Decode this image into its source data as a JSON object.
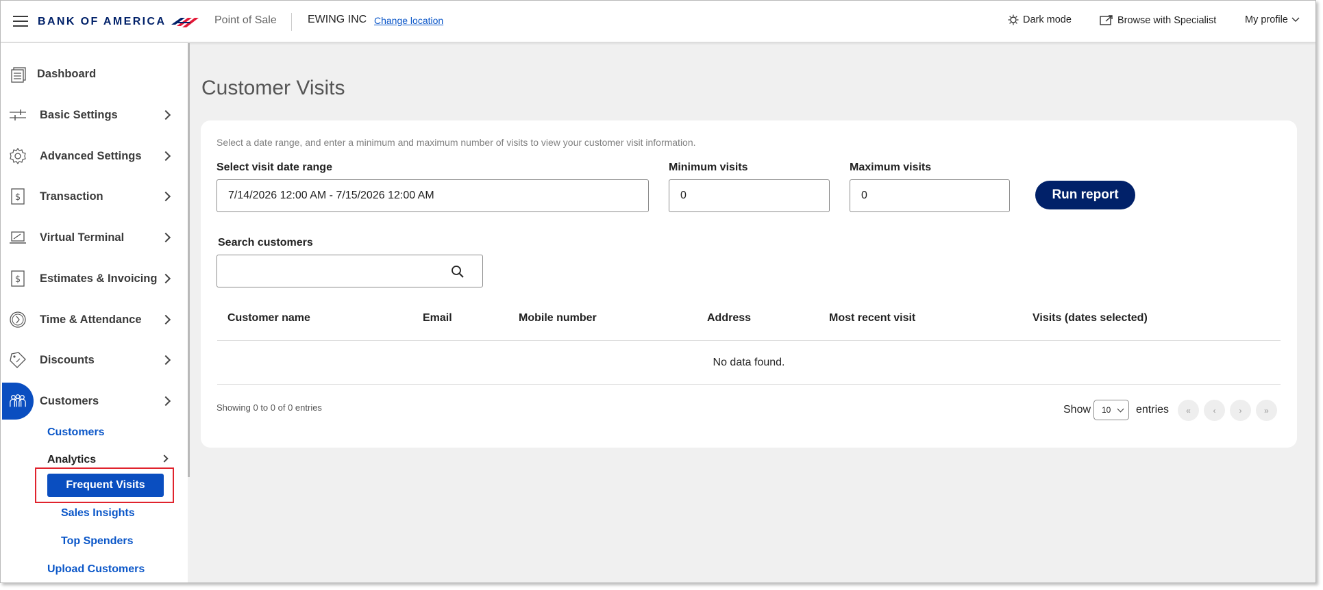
{
  "header": {
    "brand": "BANK OF AMERICA",
    "product": "Point of Sale",
    "merchant": "EWING INC",
    "change_location": "Change location",
    "dark_mode": "Dark mode",
    "browse_specialist": "Browse with Specialist",
    "my_profile": "My profile"
  },
  "sidebar": {
    "items": [
      {
        "label": "Dashboard"
      },
      {
        "label": "Basic Settings"
      },
      {
        "label": "Advanced Settings"
      },
      {
        "label": "Transaction"
      },
      {
        "label": "Virtual Terminal"
      },
      {
        "label": "Estimates & Invoicing"
      },
      {
        "label": "Time & Attendance"
      },
      {
        "label": "Discounts"
      },
      {
        "label": "Customers"
      }
    ],
    "customers_sub": {
      "customers": "Customers",
      "analytics": "Analytics",
      "frequent_visits": "Frequent Visits",
      "sales_insights": "Sales Insights",
      "top_spenders": "Top Spenders",
      "upload_customers": "Upload Customers"
    }
  },
  "main": {
    "title": "Customer Visits",
    "hint": "Select a date range, and enter a minimum and maximum number of visits to view your customer visit information.",
    "date_range_label": "Select visit date range",
    "date_range_value": "7/14/2026 12:00 AM - 7/15/2026 12:00 AM",
    "min_label": "Minimum visits",
    "min_value": "0",
    "max_label": "Maximum visits",
    "max_value": "0",
    "run_report": "Run report",
    "search_label": "Search customers",
    "search_value": "",
    "table": {
      "columns": [
        "Customer name",
        "Email",
        "Mobile number",
        "Address",
        "Most recent visit",
        "Visits (dates selected)"
      ],
      "empty": "No data found."
    },
    "showing": "Showing 0 to 0 of 0 entries",
    "show_label": "Show",
    "page_size": "10",
    "entries_label": "entries",
    "pager": [
      "«",
      "‹",
      "›",
      "»"
    ]
  },
  "colors": {
    "brand_navy": "#012169",
    "brand_red": "#e31837",
    "accent_blue": "#0a4ec0",
    "link_blue": "#0a56c8",
    "highlight_red": "#e0232d"
  }
}
